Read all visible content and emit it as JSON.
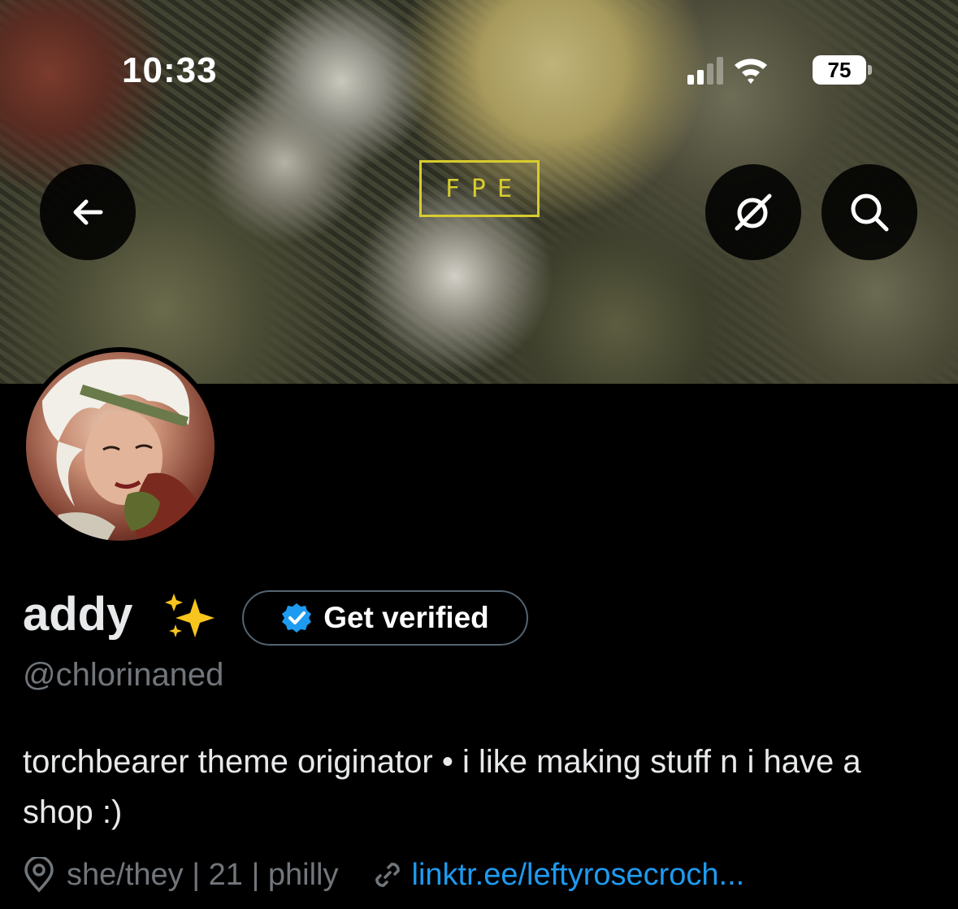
{
  "status_bar": {
    "time": "10:33",
    "battery": "75",
    "icons": [
      "cellular-signal-icon",
      "wifi-icon",
      "battery-icon"
    ]
  },
  "banner": {
    "logo_text": "FPE",
    "logo_color": "#d8cc2e"
  },
  "nav": {
    "back_icon": "arrow-left-icon",
    "grok_icon": "grok-icon",
    "search_icon": "search-icon"
  },
  "profile": {
    "display_name": "addy",
    "emoji": "sparkles",
    "get_verified_label": "Get verified",
    "handle": "@chlorinaned",
    "bio": "torchbearer theme originator • i like making stuff n i have a shop :)",
    "location": "she/they | 21 | philly",
    "website": "linktr.ee/leftyrosecroch..."
  },
  "colors": {
    "background": "#000000",
    "text_primary": "#e7e9ea",
    "text_secondary": "#71767b",
    "accent": "#1d9bf0",
    "verified_badge": "#1d9bf0",
    "sparkle": "#f7c51e"
  }
}
